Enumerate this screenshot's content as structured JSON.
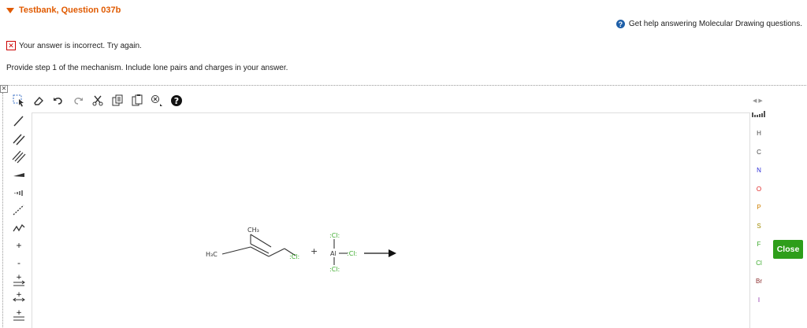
{
  "header": {
    "title": "Testbank, Question 037b"
  },
  "help": {
    "label": "Get help answering Molecular Drawing questions."
  },
  "status": {
    "message": "Your answer is incorrect.  Try again."
  },
  "instructions": {
    "text": "Provide step 1 of the mechanism. Include lone pairs and charges in your answer."
  },
  "elements": [
    "H",
    "C",
    "N",
    "O",
    "P",
    "S",
    "F",
    "Cl",
    "Br",
    "I"
  ],
  "element_colors": {
    "H": "#444444",
    "C": "#444444",
    "N": "#2a2ad8",
    "O": "#e02020",
    "P": "#d08000",
    "S": "#a08a00",
    "F": "#3aaa2a",
    "Cl": "#3aaa2a",
    "Br": "#8a2a2a",
    "I": "#8a2aa8"
  },
  "close_button": {
    "label": "Close"
  },
  "molecule": {
    "ch3": "CH₃",
    "h3c": "H₃C",
    "cl_chain": ":Cl:",
    "plus": "+",
    "cl_top": ":Cl:",
    "al": "Al",
    "cl_right": ":Cl:",
    "cl_bottom": ":Cl:"
  }
}
